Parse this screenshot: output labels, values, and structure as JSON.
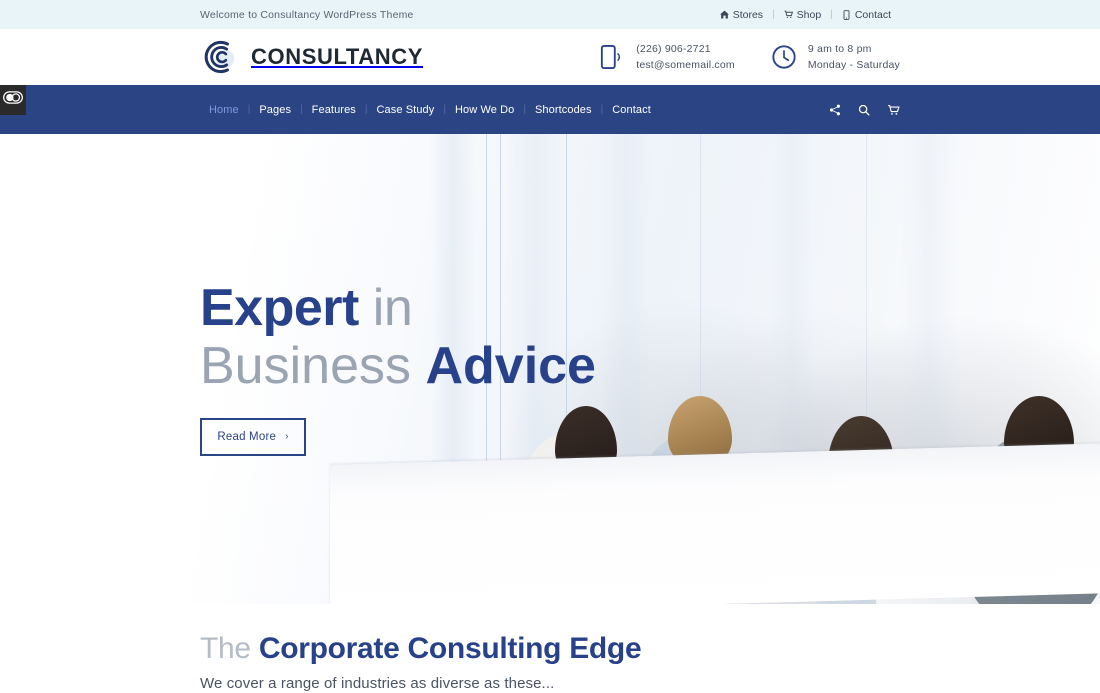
{
  "topbar": {
    "welcome": "Welcome to Consultancy WordPress Theme",
    "links": [
      {
        "label": "Stores",
        "icon": "home-icon"
      },
      {
        "label": "Shop",
        "icon": "cart-icon"
      },
      {
        "label": "Contact",
        "icon": "phone-icon"
      }
    ],
    "separator": "|",
    "bg": "#e8f4f8"
  },
  "header": {
    "brand_name": "CONSULTANCY",
    "brand_icon": "consultancy-c-logo",
    "phone": "(226) 906-2721",
    "email": "test@somemail.com",
    "hours": "9 am to 8 pm",
    "days": "Monday - Saturday",
    "phone_icon": "mobile-phone-icon",
    "clock_icon": "clock-icon"
  },
  "nav": {
    "bg": "#2b4484",
    "active_color": "#7b9ae0",
    "separator": "|",
    "items": [
      {
        "label": "Home",
        "active": true
      },
      {
        "label": "Pages",
        "active": false
      },
      {
        "label": "Features",
        "active": false
      },
      {
        "label": "Case Study",
        "active": false
      },
      {
        "label": "How We Do",
        "active": false
      },
      {
        "label": "Shortcodes",
        "active": false
      },
      {
        "label": "Contact",
        "active": false
      }
    ],
    "icons": [
      {
        "name": "share-icon"
      },
      {
        "name": "search-icon"
      },
      {
        "name": "cart-icon"
      }
    ]
  },
  "accessibility": {
    "icon": "contrast-toggle-icon",
    "label": "Accessibility"
  },
  "hero": {
    "title_line1_bold": "Expert",
    "title_line1_light": "in",
    "title_line2_light": "Business",
    "title_line2_bold": "Advice",
    "button_label": "Read More",
    "button_chevron": "›",
    "accent": "#27428a",
    "muted": "#9aa4b2"
  },
  "section": {
    "title_light": "The",
    "title_bold": "Corporate Consulting Edge",
    "subtitle": "We cover a range of industries as diverse as these..."
  }
}
